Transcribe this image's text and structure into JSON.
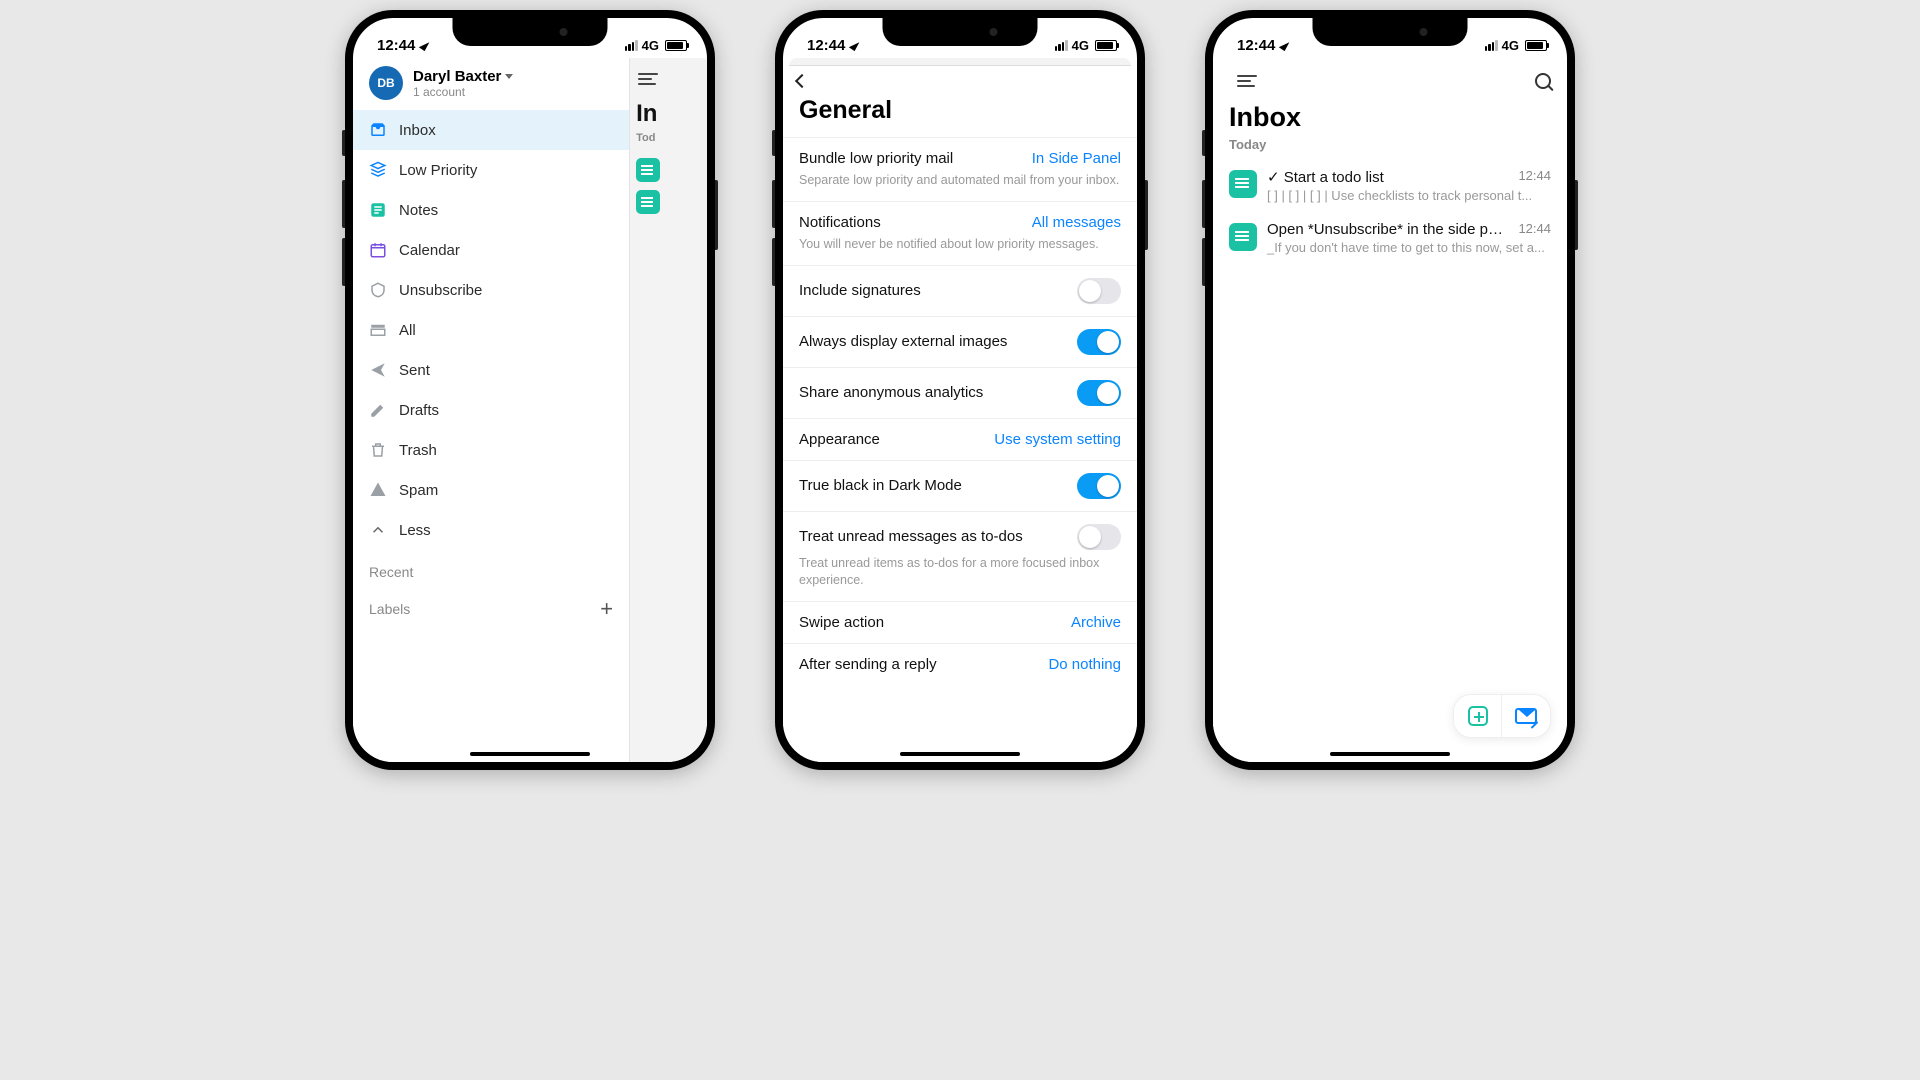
{
  "status": {
    "time": "12:44",
    "network": "4G"
  },
  "phone1": {
    "profile": {
      "initials": "DB",
      "name": "Daryl Baxter",
      "subtitle": "1 account"
    },
    "nav": [
      {
        "id": "inbox",
        "label": "Inbox",
        "color": "#0a84ff",
        "active": true
      },
      {
        "id": "lowpriority",
        "label": "Low Priority",
        "color": "#0a84ff"
      },
      {
        "id": "notes",
        "label": "Notes",
        "color": "#1ac1a3"
      },
      {
        "id": "calendar",
        "label": "Calendar",
        "color": "#7a4fe0"
      },
      {
        "id": "unsubscribe",
        "label": "Unsubscribe",
        "color": "#9aa0a6"
      },
      {
        "id": "all",
        "label": "All",
        "color": "#9aa0a6"
      },
      {
        "id": "sent",
        "label": "Sent",
        "color": "#9aa0a6"
      },
      {
        "id": "drafts",
        "label": "Drafts",
        "color": "#9aa0a6"
      },
      {
        "id": "trash",
        "label": "Trash",
        "color": "#9aa0a6"
      },
      {
        "id": "spam",
        "label": "Spam",
        "color": "#9aa0a6"
      },
      {
        "id": "less",
        "label": "Less",
        "color": "#9aa0a6"
      }
    ],
    "recent_label": "Recent",
    "labels_label": "Labels",
    "peek": {
      "title": "In",
      "today": "Tod"
    }
  },
  "phone2": {
    "title": "General",
    "settings": {
      "bundle": {
        "label": "Bundle low priority mail",
        "value": "In Side Panel",
        "desc": "Separate low priority and automated mail from your inbox."
      },
      "notif": {
        "label": "Notifications",
        "value": "All messages",
        "desc": "You will never be notified about low priority messages."
      },
      "sigs": {
        "label": "Include signatures"
      },
      "extimg": {
        "label": "Always display external images"
      },
      "analytics": {
        "label": "Share anonymous analytics"
      },
      "appear": {
        "label": "Appearance",
        "value": "Use system setting"
      },
      "trueblack": {
        "label": "True black in Dark Mode"
      },
      "unread": {
        "label": "Treat unread messages as to-dos",
        "desc": "Treat unread items as to-dos for a more focused inbox experience."
      },
      "swipe": {
        "label": "Swipe action",
        "value": "Archive"
      },
      "aftersend": {
        "label": "After sending a reply",
        "value": "Do nothing"
      }
    }
  },
  "phone3": {
    "title": "Inbox",
    "today": "Today",
    "msgs": [
      {
        "title": "✓ Start a todo list",
        "time": "12:44",
        "preview": "[ ] | [ ] | [ ] | Use checklists to track personal t..."
      },
      {
        "title": "Open *Unsubscribe* in the side pan...",
        "time": "12:44",
        "preview": "_If you don't have time to get to this now, set a..."
      }
    ]
  }
}
